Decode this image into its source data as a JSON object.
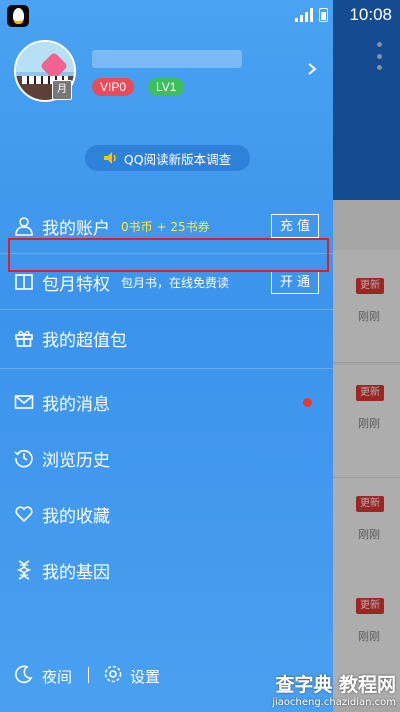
{
  "status_bar": {
    "time": "10:08"
  },
  "profile": {
    "username": "",
    "vip_badge": "VIP0",
    "level_badge": "LV1",
    "month_tag": "月"
  },
  "survey": {
    "label": "QQ阅读新版本调查"
  },
  "menu": {
    "account": {
      "label": "我的账户",
      "balance": "0书币 + 25书券",
      "button": "充 值"
    },
    "monthly": {
      "label": "包月特权",
      "desc": "包月书，在线免费读",
      "button": "开 通"
    },
    "super_pack": {
      "label": "我的超值包"
    },
    "messages": {
      "label": "我的消息"
    },
    "history": {
      "label": "浏览历史"
    },
    "favorites": {
      "label": "我的收藏"
    },
    "genes": {
      "label": "我的基因"
    }
  },
  "bottom": {
    "night": "夜间",
    "settings": "设置"
  },
  "background": {
    "rows": [
      {
        "badge": "更新",
        "time": "刚刚"
      },
      {
        "badge": "更新",
        "time": "刚刚"
      },
      {
        "badge": "更新",
        "time": "刚刚"
      },
      {
        "badge": "更新",
        "time": "刚刚"
      }
    ]
  },
  "watermark": {
    "site": "查字典 教程网",
    "url": "jiaocheng.chazidian.com"
  },
  "colors": {
    "drawer": "#3b93ec",
    "highlight": "#e02020",
    "vip": "#e84b5a",
    "level": "#3cbf5c",
    "balance": "#ffeb3b"
  }
}
